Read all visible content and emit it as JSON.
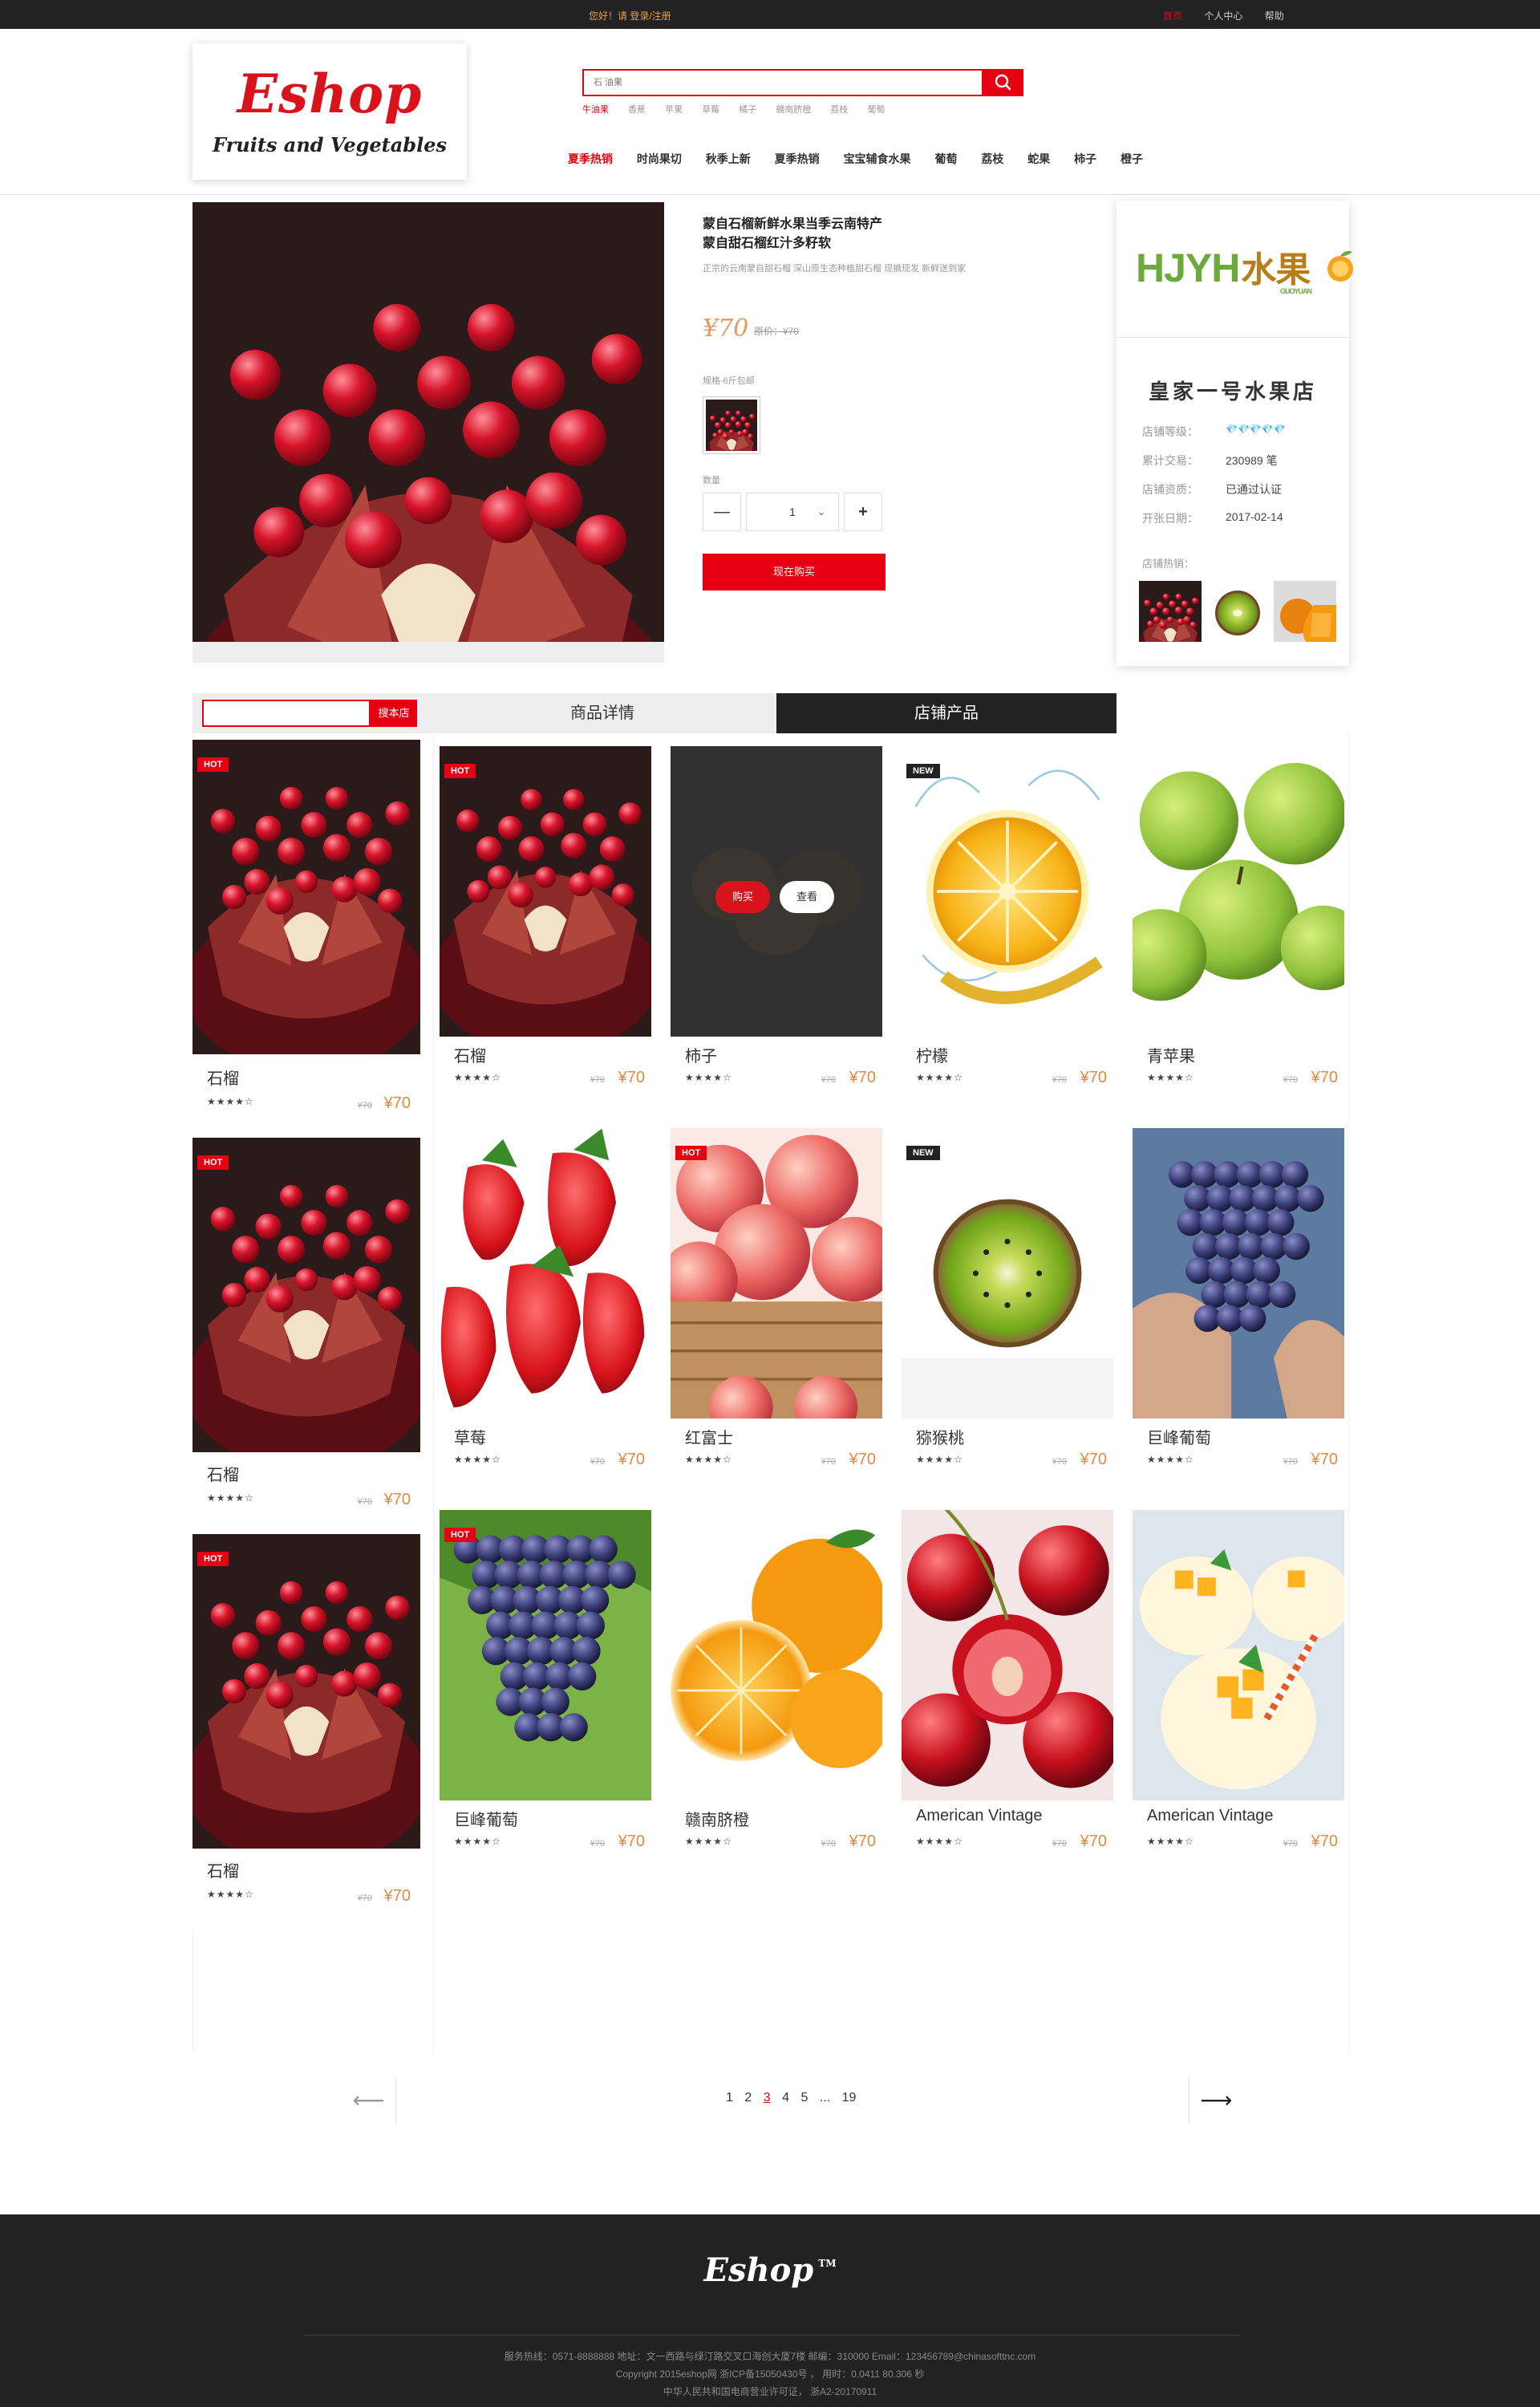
{
  "topbar": {
    "greeting": "您好！请 登录/注册",
    "links": [
      "首页",
      "个人中心",
      "帮助"
    ]
  },
  "logo": {
    "title": "Eshop",
    "subtitle": "Fruits and Vegetables"
  },
  "search": {
    "placeholder": "石 油果",
    "hotwords": [
      "牛油果",
      "香蕉",
      "苹果",
      "草莓",
      "橘子",
      "赣南脐橙",
      "荔枝",
      "葡萄"
    ]
  },
  "nav": [
    "夏季热销",
    "时尚果切",
    "秋季上新",
    "夏季热销",
    "宝宝辅食水果",
    "葡萄",
    "荔枝",
    "蛇果",
    "柿子",
    "橙子"
  ],
  "product": {
    "title_line1": "蒙自石榴新鲜水果当季云南特产",
    "title_line2": "蒙自甜石榴红汁多籽软",
    "desc": "正宗的云南蒙自甜石榴 深山原生态种植甜石榴 现摘现发 新鲜送到家",
    "price": "¥70",
    "orig_price": "原价：¥70",
    "spec_label": "规格-6斤包邮",
    "qty_label": "数量",
    "qty_minus": "—",
    "qty_value": "1",
    "qty_plus": "+",
    "buy_label": "现在购买"
  },
  "shop": {
    "logo_text": "HJYH",
    "logo_cn": "水果",
    "logo_sub": "GUOYUAN",
    "name": "皇家一号水果店",
    "rows": [
      {
        "label": "店铺等级：",
        "value": "💎💎💎💎💎"
      },
      {
        "label": "累计交易：",
        "value": "230989 笔"
      },
      {
        "label": "店铺资质：",
        "value": "已通过认证"
      },
      {
        "label": "开张日期：",
        "value": "2017-02-14"
      }
    ],
    "hot_label": "店铺热销："
  },
  "tabs": {
    "search_btn": "搜本店",
    "detail": "商品详情",
    "products": "店铺产品"
  },
  "products": [
    {
      "name": "石榴",
      "badge": "HOT",
      "stars": "★★★★☆",
      "orig": "¥70",
      "price": "¥70"
    },
    {
      "name": "石榴",
      "badge": "HOT",
      "stars": "★★★★☆",
      "orig": "¥70",
      "price": "¥70"
    },
    {
      "name": "柿子",
      "badge": "",
      "stars": "★★★★☆",
      "orig": "¥70",
      "price": "¥70",
      "btn_buy": "购买",
      "btn_view": "查看"
    },
    {
      "name": "柠檬",
      "badge": "NEW",
      "stars": "★★★★☆",
      "orig": "¥70",
      "price": "¥70"
    },
    {
      "name": "青苹果",
      "badge": "",
      "stars": "★★★★☆",
      "orig": "¥70",
      "price": "¥70"
    },
    {
      "name": "石榴",
      "badge": "HOT",
      "stars": "★★★★☆",
      "orig": "¥70",
      "price": "¥70"
    },
    {
      "name": "草莓",
      "badge": "",
      "stars": "★★★★☆",
      "orig": "¥70",
      "price": "¥70"
    },
    {
      "name": "红富士",
      "badge": "HOT",
      "stars": "★★★★☆",
      "orig": "¥70",
      "price": "¥70"
    },
    {
      "name": "猕猴桃",
      "badge": "NEW",
      "stars": "★★★★☆",
      "orig": "¥70",
      "price": "¥70"
    },
    {
      "name": "巨峰葡萄",
      "badge": "",
      "stars": "★★★★☆",
      "orig": "¥70",
      "price": "¥70"
    },
    {
      "name": "石榴",
      "badge": "HOT",
      "stars": "★★★★☆",
      "orig": "¥70",
      "price": "¥70"
    },
    {
      "name": "巨峰葡萄",
      "badge": "HOT",
      "stars": "★★★★☆",
      "orig": "¥70",
      "price": "¥70"
    },
    {
      "name": "赣南脐橙",
      "badge": "",
      "stars": "★★★★☆",
      "orig": "¥70",
      "price": "¥70"
    },
    {
      "name": "American Vintage",
      "badge": "",
      "stars": "★★★★☆",
      "orig": "¥70",
      "price": "¥70"
    },
    {
      "name": "American Vintage",
      "badge": "",
      "stars": "★★★★☆",
      "orig": "¥70",
      "price": "¥70"
    }
  ],
  "pagination": {
    "prev": "⟵",
    "next": "⟶",
    "pages": [
      "1",
      "2",
      "3",
      "4",
      "5",
      "...",
      "19"
    ],
    "current": "3"
  },
  "footer": {
    "logo": "Eshop",
    "tm": "TM",
    "line1": "服务热线：0571-8888888     地址：文一西路与绿汀路交叉口海创大厦7楼     邮编：310000     Email：123456789@chinasofttnc.com",
    "line2": "Copyright 2015eshop网    浙ICP备15050430号 ，    用时：0.0411 80.306 秒",
    "line3": "中华人民共和国电商营业许可证，  浙A2-20170911"
  }
}
